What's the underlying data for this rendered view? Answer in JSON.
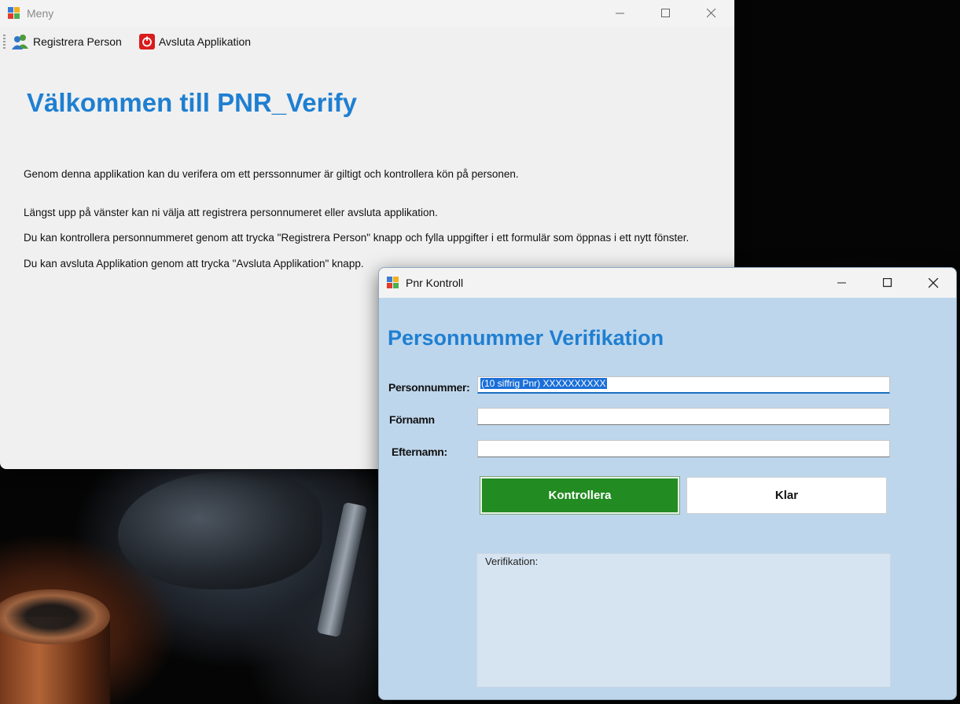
{
  "main_window": {
    "title": "Meny",
    "toolbar": {
      "register_label": "Registrera Person",
      "exit_label": "Avsluta Applikation"
    },
    "welcome_title": "Välkommen till PNR_Verify",
    "paragraphs": [
      "Genom denna applikation kan du verifera om ett perssonnumer är giltigt och kontrollera kön på personen.",
      "Längst upp på vänster kan ni  välja att registrera personnumeret eller avsluta applikation.",
      "Du kan kontrollera personnummeret genom att trycka \"Registrera Person\" knapp och fylla uppgifter i ett formulär som öppnas i ett nytt fönster.",
      "Du kan avsluta Applikation genom att trycka  \"Avsluta Applikation\" knapp."
    ]
  },
  "pnr_window": {
    "title": "Pnr Kontroll",
    "heading": "Personnummer Verifikation",
    "fields": {
      "pnr_label": "Personnummer:",
      "pnr_value": "(10 siffrig Pnr) XXXXXXXXXX",
      "firstname_label": "Förnamn",
      "firstname_value": "",
      "lastname_label": "Efternamn:",
      "lastname_value": ""
    },
    "buttons": {
      "check_label": "Kontrollera",
      "done_label": "Klar"
    },
    "verification_label": "Verifikation:"
  },
  "colors": {
    "accent": "#1f7fd1",
    "check_button": "#228b22",
    "pnr_window_bg": "#bed6ec"
  }
}
